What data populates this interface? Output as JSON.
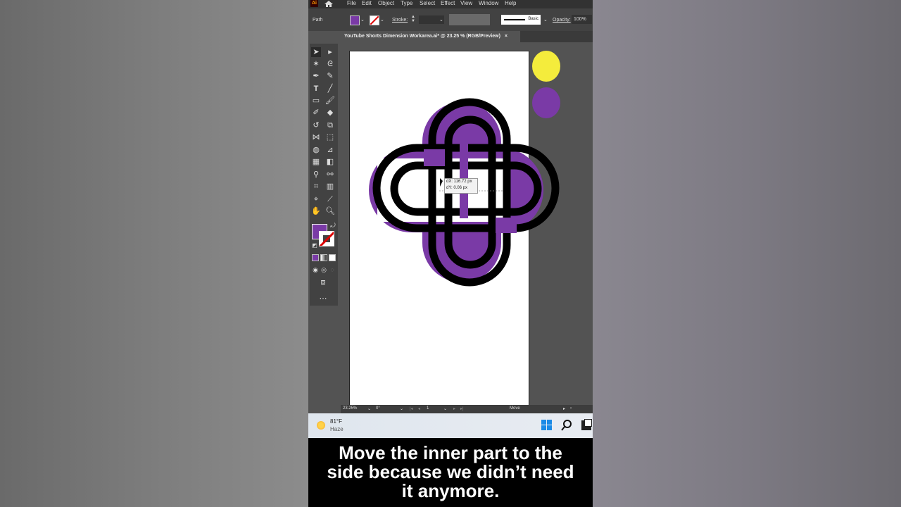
{
  "menubar": {
    "logo": "Ai",
    "items": [
      "File",
      "Edit",
      "Object",
      "Type",
      "Select",
      "Effect",
      "View",
      "Window",
      "Help"
    ]
  },
  "control_bar": {
    "selection_type": "Path",
    "stroke_label": "Stroke:",
    "brush_style": "Basic",
    "opacity_label": "Opacity:",
    "opacity_value": "100%",
    "fill_color": "#7a3aa6",
    "stroke_color": "none"
  },
  "document_tab": {
    "title": "YouTube Shorts Dimension Workarea.ai* @ 23.25 % (RGB/Preview)",
    "close": "×"
  },
  "tooltip": {
    "dx": "dX: 116.72 px",
    "dy": "dY: 0.06 px"
  },
  "status_bar": {
    "zoom": "23.25%",
    "rotation": "0°",
    "artboard_number": "1",
    "tool_name": "Move"
  },
  "taskbar": {
    "temperature": "81°F",
    "condition": "Haze"
  },
  "caption": {
    "line1": "Move the inner part to the",
    "line2": "side because we didn’t need",
    "line3": "it anymore."
  },
  "colors": {
    "purple": "#7a3aa6",
    "yellow": "#f4ec3c",
    "black": "#000000"
  }
}
